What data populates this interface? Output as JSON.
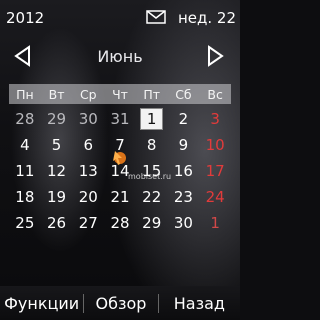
{
  "status": {
    "year": "2012",
    "week_label": "нед. 22",
    "mail_icon": "envelope-icon"
  },
  "month_nav": {
    "month": "Июнь",
    "prev_icon": "triangle-left-icon",
    "next_icon": "triangle-right-icon"
  },
  "calendar": {
    "weekdays": [
      "Пн",
      "Вт",
      "Ср",
      "Чт",
      "Пт",
      "Сб",
      "Вс"
    ],
    "weeks": [
      [
        "28",
        "29",
        "30",
        "31",
        "1",
        "2",
        "3"
      ],
      [
        "4",
        "5",
        "6",
        "7",
        "8",
        "9",
        "10"
      ],
      [
        "11",
        "12",
        "13",
        "14",
        "15",
        "16",
        "17"
      ],
      [
        "18",
        "19",
        "20",
        "21",
        "22",
        "23",
        "24"
      ],
      [
        "25",
        "26",
        "27",
        "28",
        "29",
        "30",
        "1"
      ]
    ],
    "selected_day": "1",
    "weekend_color": "#e23b3b"
  },
  "watermark": "mobiset.ru",
  "softkeys": {
    "left": "Функции",
    "middle": "Обзор",
    "right": "Назад"
  }
}
